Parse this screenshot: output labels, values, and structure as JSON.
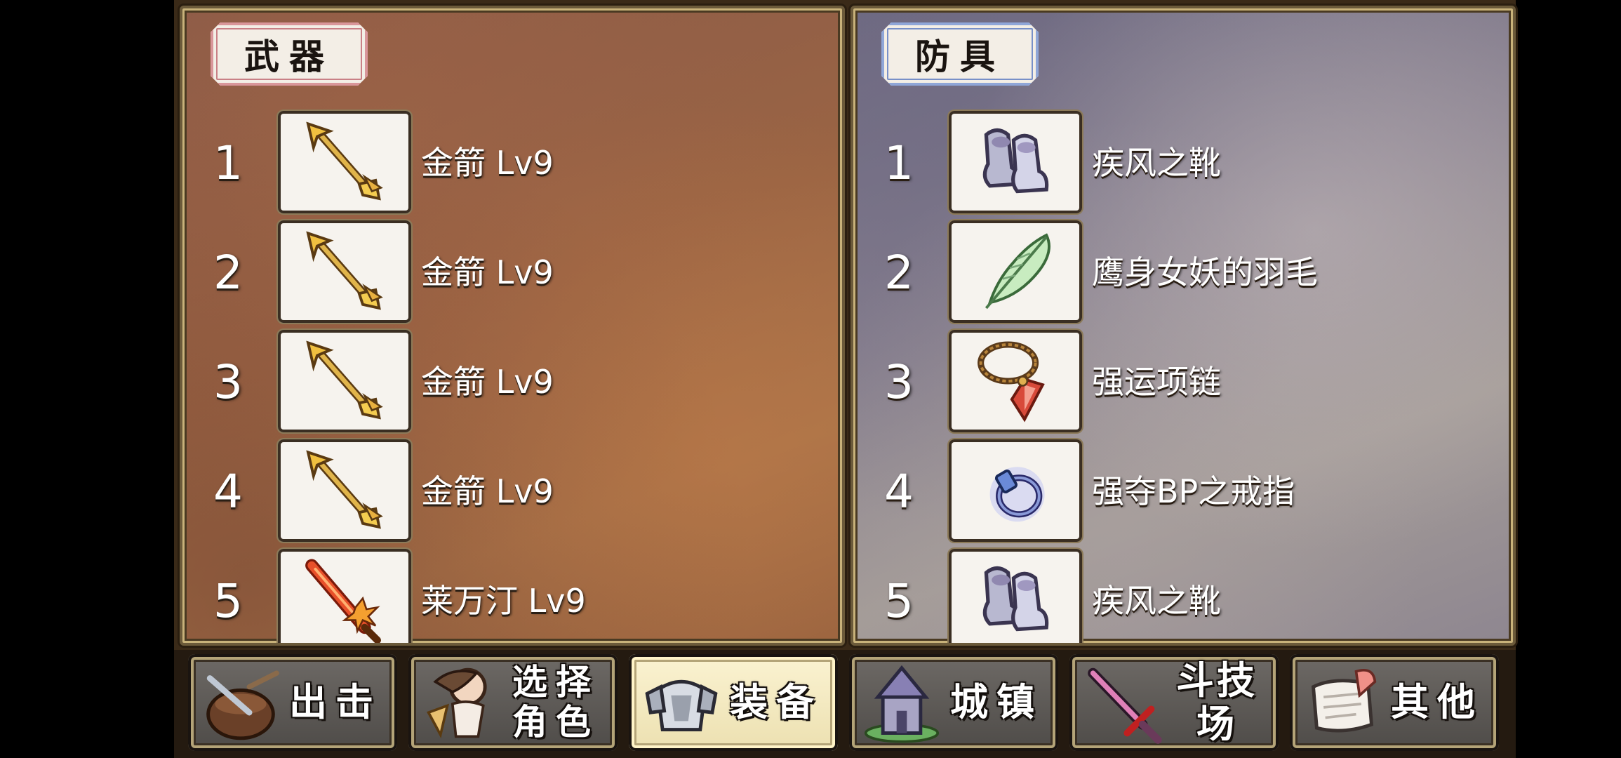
{
  "weapons": {
    "title": "武器",
    "items": [
      {
        "num": "1",
        "name": "金箭 Lv9",
        "icon": "golden-arrow-icon"
      },
      {
        "num": "2",
        "name": "金箭 Lv9",
        "icon": "golden-arrow-icon"
      },
      {
        "num": "3",
        "name": "金箭 Lv9",
        "icon": "golden-arrow-icon"
      },
      {
        "num": "4",
        "name": "金箭 Lv9",
        "icon": "golden-arrow-icon"
      },
      {
        "num": "5",
        "name": "莱万汀 Lv9",
        "icon": "flame-sword-icon"
      }
    ]
  },
  "armor": {
    "title": "防具",
    "items": [
      {
        "num": "1",
        "name": "疾风之靴",
        "icon": "boots-icon"
      },
      {
        "num": "2",
        "name": "鹰身女妖的羽毛",
        "icon": "feather-icon"
      },
      {
        "num": "3",
        "name": "强运项链",
        "icon": "necklace-icon"
      },
      {
        "num": "4",
        "name": "强夺BP之戒指",
        "icon": "ring-icon"
      },
      {
        "num": "5",
        "name": "疾风之靴",
        "icon": "boots-icon"
      }
    ]
  },
  "nav": {
    "sortie": {
      "label": "出击",
      "icon": "sortie-icon"
    },
    "character": {
      "label_line1": "选择",
      "label_line2": "角色",
      "icon": "character-icon"
    },
    "equipment": {
      "label": "装备",
      "icon": "armor-icon",
      "active": true
    },
    "town": {
      "label": "城镇",
      "icon": "town-icon"
    },
    "arena": {
      "label": "斗技场",
      "icon": "sword-icon"
    },
    "other": {
      "label": "其他",
      "icon": "scroll-icon"
    }
  },
  "colors": {
    "weapon_tag_border": "#d9969a",
    "armor_tag_border": "#8fa6d8",
    "active_nav": "#fbf3d2"
  }
}
